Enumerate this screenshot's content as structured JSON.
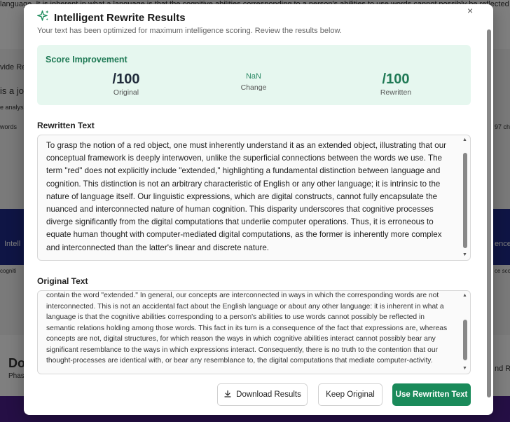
{
  "background": {
    "line1": "language. It is inherent in what a language is that the cognitive abilities corresponding to a person's abilities to use words cannot possibly be reflected in",
    "fragments": [
      "vide Re",
      "is a jo",
      "e analysi",
      "words",
      "Intell",
      "cogniti",
      "Do",
      "Phas",
      "ence",
      "ce score",
      "nd Rep",
      "97 ch"
    ]
  },
  "modal": {
    "title": "Intelligent Rewrite Results",
    "subtitle": "Your text has been optimized for maximum intelligence scoring. Review the results below.",
    "close": "×"
  },
  "score": {
    "heading": "Score Improvement",
    "original_value": "/100",
    "original_label": "Original",
    "change_value": "NaN",
    "change_label": "Change",
    "rewritten_value": "/100",
    "rewritten_label": "Rewritten"
  },
  "rewritten": {
    "label": "Rewritten Text",
    "text": "To grasp the notion of a red object, one must inherently understand it as an extended object, illustrating that our conceptual framework is deeply interwoven, unlike the superficial connections between the words we use. The term \"red\" does not explicitly include \"extended,\" highlighting a fundamental distinction between language and cognition. This distinction is not an arbitrary characteristic of English or any other language; it is intrinsic to the nature of language itself. Our linguistic expressions, which are digital constructs, cannot fully encapsulate the nuanced and interconnected nature of human cognition. This disparity underscores that cognitive processes diverge significantly from the digital computations that underlie computer operations. Thus, it is erroneous to equate human thought with computer-mediated digital computations, as the former is inherently more complex and interconnected than the latter's linear and discrete nature."
  },
  "original": {
    "label": "Original Text",
    "text": "contain the word \"extended.\" In general, our concepts are interconnected in ways in which the corresponding words are not interconnected. This is not an accidental fact about the English language or about any other language: it is inherent in what a language is that the cognitive abilities corresponding to a person's abilities to use words cannot possibly be reflected in semantic relations holding among those words. This fact in its turn is a consequence of the fact that expressions are, whereas concepts are not, digital structures, for which reason the ways in which cognitive abilities interact cannot possibly bear any significant resemblance to the ways in which expressions interact. Consequently, there is no truth to the contention that our thought-processes are identical with, or bear any resemblance to, the digital computations that mediate computer-activity."
  },
  "actions": {
    "download": "Download Results",
    "keep": "Keep Original",
    "use": "Use Rewritten Text"
  },
  "colors": {
    "accent": "#1a8a5a",
    "score_bg": "#e6f7ef",
    "score_value": "#1f7a55"
  }
}
